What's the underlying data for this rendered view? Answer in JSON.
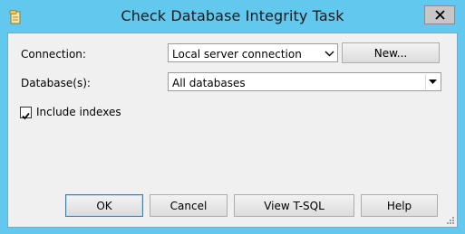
{
  "window": {
    "title": "Check Database Integrity Task",
    "app_icon": "task-wizard-icon",
    "close_icon": "close-icon"
  },
  "form": {
    "connection_label": "Connection:",
    "connection_value": "Local server connection",
    "new_button": "New...",
    "databases_label": "Database(s):",
    "databases_value": "All databases",
    "include_indexes_label": "Include indexes",
    "include_indexes_checked": true
  },
  "buttons": {
    "ok": "OK",
    "cancel": "Cancel",
    "view_tsql": "View T-SQL",
    "help": "Help"
  },
  "colors": {
    "titlebar": "#62c8ee",
    "client": "#f0f0f0",
    "close_button": "#c7c7c7"
  }
}
